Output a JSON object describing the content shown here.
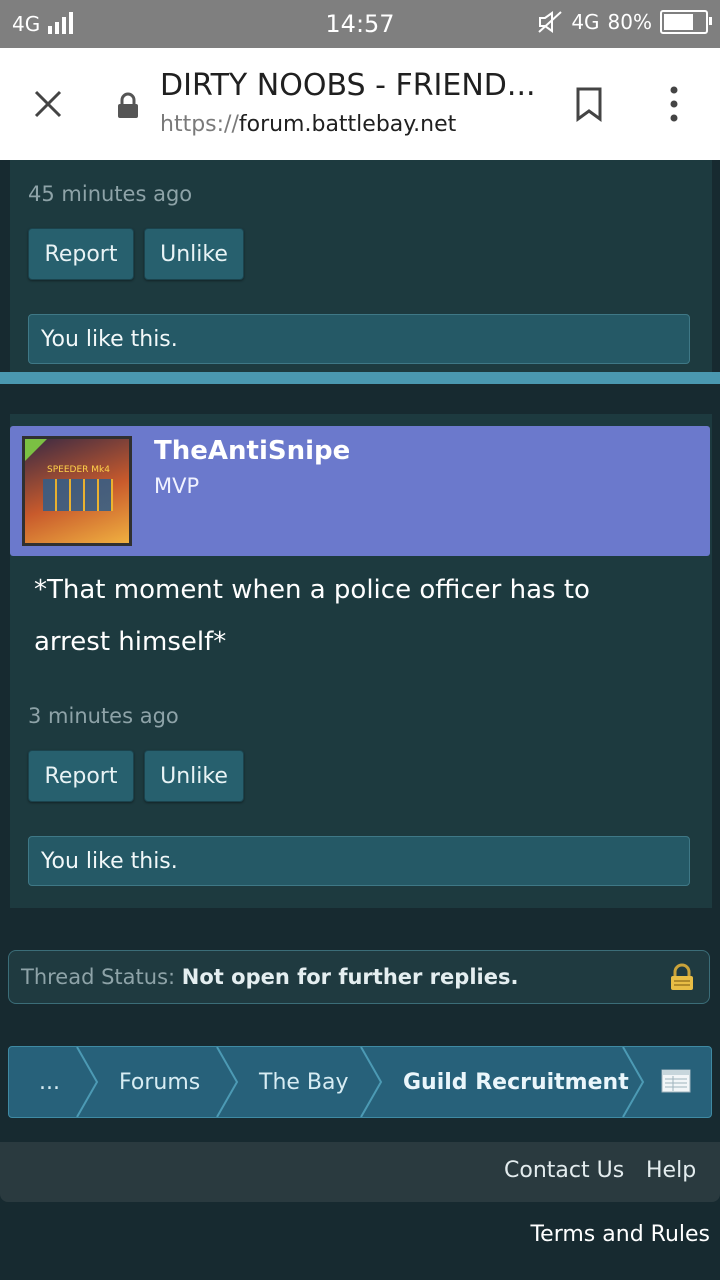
{
  "status_bar": {
    "network_left": "4G",
    "time": "14:57",
    "network_right": "4G",
    "battery_percent": "80%",
    "battery_level": 0.8
  },
  "browser": {
    "page_title": "DIRTY NOOBS - FRIEND...",
    "url_scheme": "https://",
    "url_host": "forum.battlebay.net"
  },
  "posts": [
    {
      "time": "45 minutes ago",
      "report_label": "Report",
      "unlike_label": "Unlike",
      "likes_text": "You like this."
    },
    {
      "username": "TheAntiSnipe",
      "rank": "MVP",
      "avatar_text": "SPEEDER Mk4",
      "message": "*That moment when a police officer has to arrest himself*",
      "time": "3 minutes ago",
      "report_label": "Report",
      "unlike_label": "Unlike",
      "likes_text": "You like this."
    }
  ],
  "thread_status": {
    "label": "Thread Status:",
    "value": "Not open for further replies."
  },
  "breadcrumb": [
    "...",
    "Forums",
    "The Bay",
    "Guild Recruitment"
  ],
  "footer": {
    "contact": "Contact Us",
    "help": "Help",
    "terms": "Terms and Rules"
  },
  "colors": {
    "page_bg": "#172a30",
    "post_bg": "#1d3a3f",
    "button_bg": "#27606e",
    "userbar_bg": "#6b79cc",
    "accent_divider": "#4a98b0"
  }
}
